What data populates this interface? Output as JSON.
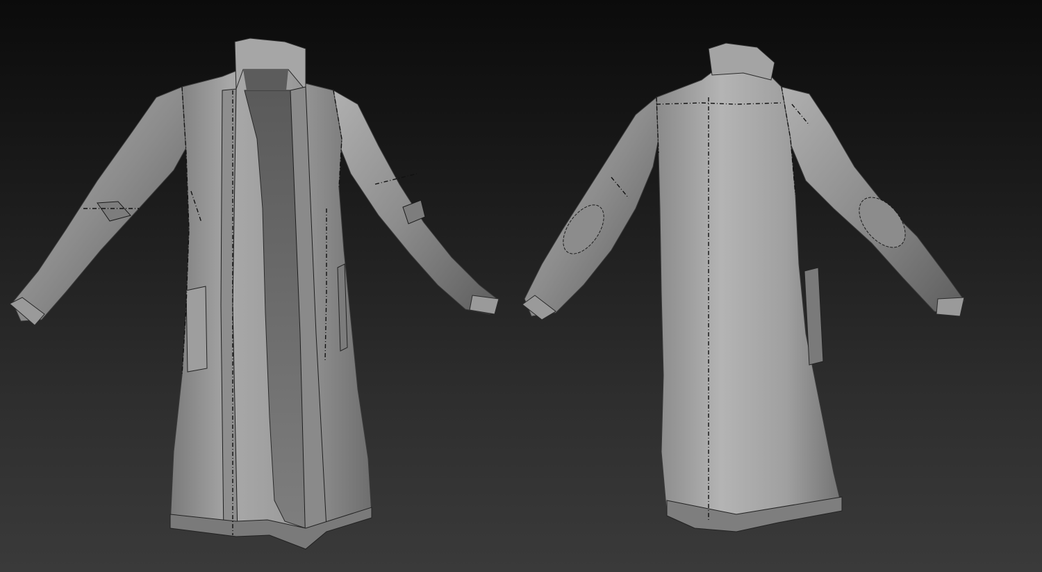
{
  "scene": {
    "background_top": "#0b0b0b",
    "background_bottom": "#3a3a3a",
    "clay_light": "#b8b8b8",
    "clay_mid": "#8a8a8a",
    "clay_dark": "#4a4a4a",
    "seam_color": "#111111",
    "models": [
      {
        "name": "coat-front-view",
        "view": "front"
      },
      {
        "name": "coat-back-view",
        "view": "back"
      }
    ]
  }
}
